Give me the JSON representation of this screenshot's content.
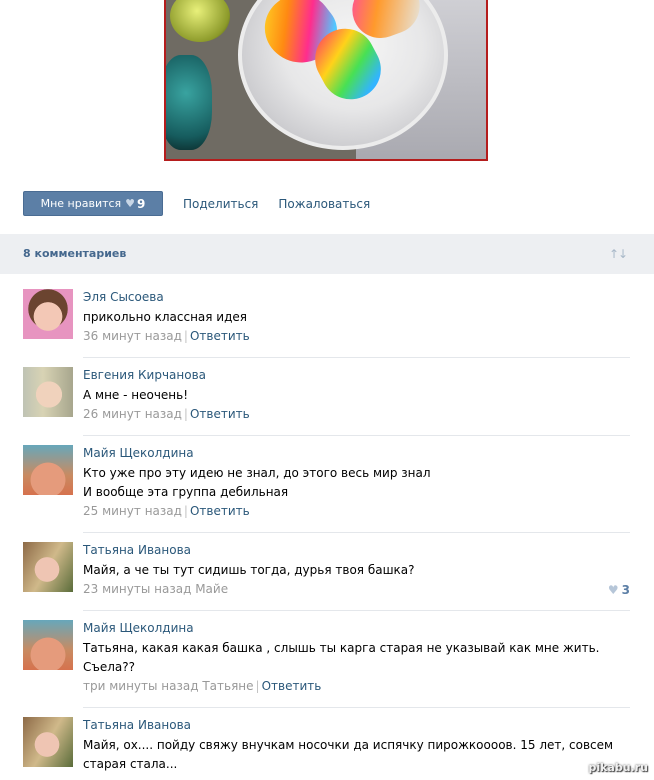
{
  "post": {
    "like_label": "Мне нравится",
    "like_count": "9",
    "share_label": "Поделиться",
    "report_label": "Пожаловаться",
    "like_icon": "heart-icon"
  },
  "comments_header": {
    "title": "8 комментариев",
    "sort_icon": "sort-arrows-icon"
  },
  "comments": [
    {
      "author": "Эля Сысоева",
      "lines": [
        "прикольно классная идея"
      ],
      "time": "36 минут назад",
      "reply_label": "Ответить"
    },
    {
      "author": "Евгения Кирчанова",
      "lines": [
        "А мне - неочень!"
      ],
      "time": "26 минут назад",
      "reply_label": "Ответить"
    },
    {
      "author": "Майя Щеколдина",
      "lines": [
        "Кто уже про эту идею не знал, до этого весь мир знал",
        "И вообще эта группа дебильная"
      ],
      "time": "25 минут назад",
      "reply_label": "Ответить"
    },
    {
      "author": "Татьяна Иванова",
      "lines": [
        "Майя, а че ты тут сидишь тогда, дурья твоя башка?"
      ],
      "time": "23 минуты назад Майе",
      "likes": "3"
    },
    {
      "author": "Майя Щеколдина",
      "lines": [
        "Татьяна, какая какая башка , слышь ты карга старая не указывай как мне жить.",
        "Съела??"
      ],
      "time": "три минуты назад Татьяне",
      "reply_label": "Ответить"
    },
    {
      "author": "Татьяна Иванова",
      "lines": [
        "Майя, ох.... пойду свяжу внучкам носочки да испячку пирожкоооов. 15 лет, совсем",
        "старая стала..."
      ]
    }
  ],
  "watermark": "pikabu.ru"
}
